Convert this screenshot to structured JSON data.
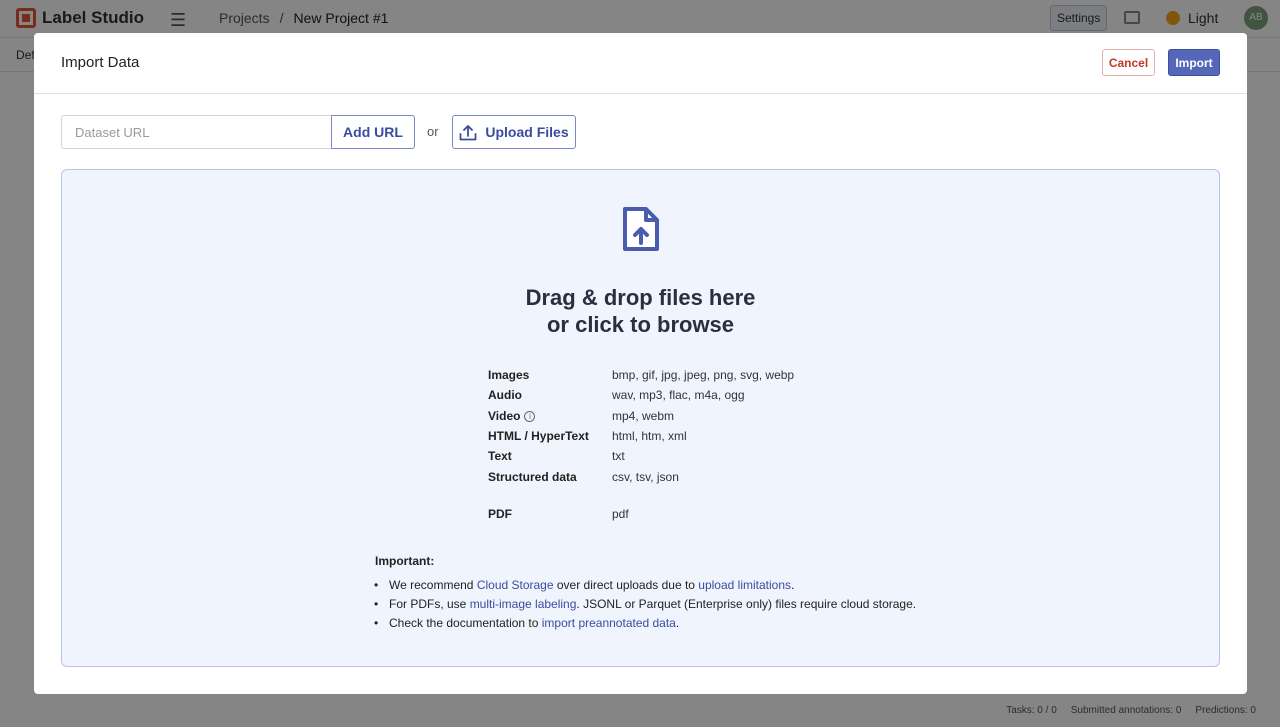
{
  "app": {
    "logo_text": "Label Studio",
    "breadcrumb": [
      "Projects",
      "/",
      "New Project #1"
    ],
    "settings_label": "Settings",
    "theme_label": "Light",
    "avatar_initials": "AB",
    "subtab_label": "Default",
    "status": [
      "Tasks: 0 / 0",
      "Submitted annotations: 0",
      "Predictions: 0"
    ]
  },
  "modal": {
    "title": "Import Data",
    "cancel_label": "Cancel",
    "import_label": "Import",
    "url_placeholder": "Dataset URL",
    "add_url_label": "Add URL",
    "or_text": "or",
    "upload_label": "Upload Files",
    "drop_line1": "Drag & drop files here",
    "drop_line2": "or click to browse",
    "formats": [
      {
        "name": "Images",
        "ext": "bmp, gif, jpg, jpeg, png, svg, webp"
      },
      {
        "name": "Audio",
        "ext": "wav, mp3, flac, m4a, ogg"
      },
      {
        "name": "Video",
        "ext": "mp4, webm"
      },
      {
        "name": "HTML / HyperText",
        "ext": "html, htm, xml"
      },
      {
        "name": "Text",
        "ext": "txt"
      },
      {
        "name": "Structured data",
        "ext": "csv, tsv, json"
      },
      {
        "name": "PDF",
        "ext": "pdf"
      }
    ],
    "important_label": "Important:",
    "notes": {
      "n1_a": "We recommend ",
      "n1_link1": "Cloud Storage",
      "n1_b": " over direct uploads due to ",
      "n1_link2": "upload limitations",
      "n1_c": ".",
      "n2_a": "For PDFs, use ",
      "n2_link": "multi-image labeling",
      "n2_b": ". JSONL or Parquet (Enterprise only) files require cloud storage.",
      "n3_a": "Check the documentation to ",
      "n3_link": "import preannotated data",
      "n3_b": "."
    }
  },
  "colors": {
    "accent": "#3a4ca0",
    "import_button": "#5567b8",
    "cancel_text": "#c0392b",
    "dropzone_bg": "#f0f4fd"
  }
}
